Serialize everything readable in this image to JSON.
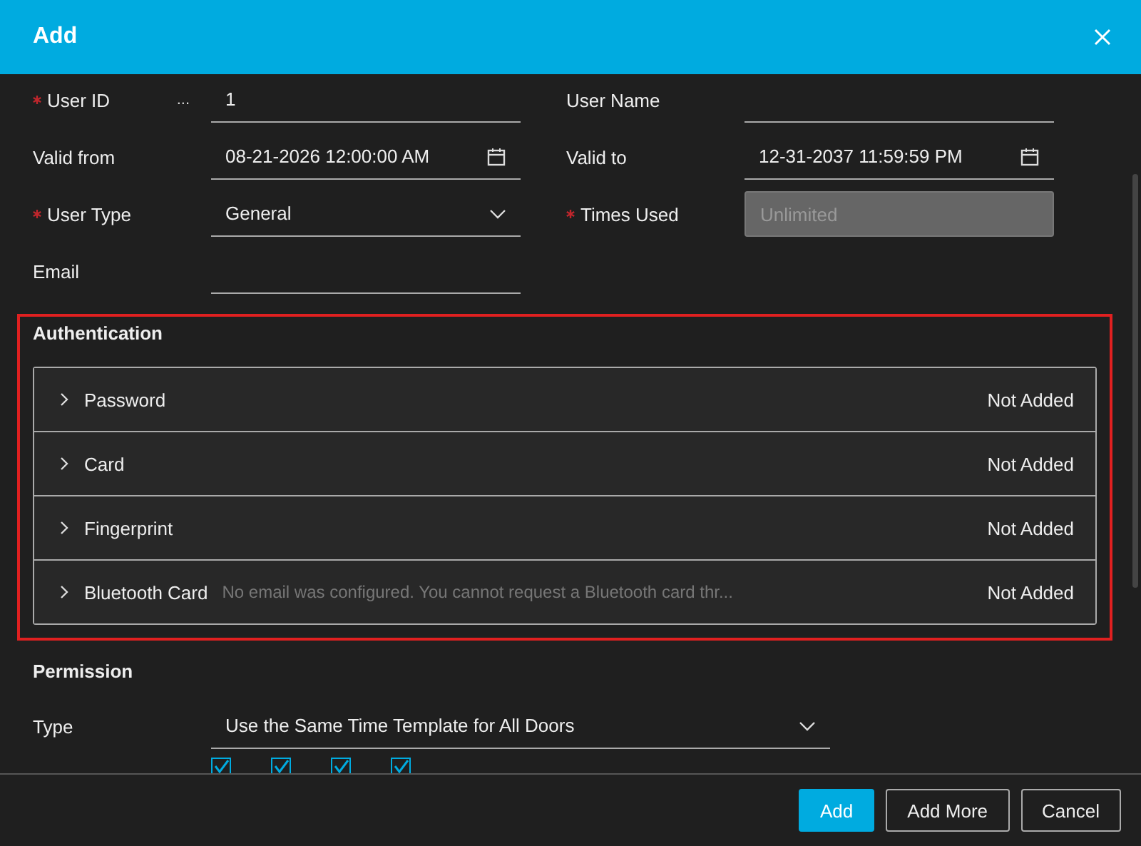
{
  "window": {
    "title": "Add"
  },
  "fields": [
    {
      "label": "User ID",
      "required": true,
      "kind": "text",
      "value": "1",
      "more": "..."
    },
    {
      "label": "User Name",
      "required": false,
      "kind": "text"
    },
    {
      "label": "Valid from",
      "required": false,
      "kind": "date",
      "value": "08-21-2026 12:00:00 AM"
    },
    {
      "label": "Valid to",
      "required": false,
      "kind": "date",
      "value": "12-31-2037 11:59:59 PM"
    },
    {
      "label": "User Type",
      "required": true,
      "kind": "select",
      "value": "General"
    },
    {
      "label": "Times Used",
      "required": true,
      "kind": "disabled",
      "placeholder": "Unlimited"
    },
    {
      "label": "Email",
      "required": false,
      "kind": "text"
    }
  ],
  "authentication": {
    "title": "Authentication",
    "items": [
      {
        "name": "Password",
        "status": "Not Added",
        "expanded": false
      },
      {
        "name": "Card",
        "status": "Not Added",
        "expanded": false
      },
      {
        "name": "Fingerprint",
        "status": "Not Added",
        "expanded": false
      },
      {
        "name": "Bluetooth Card",
        "note": "No email was configured. You cannot request a Bluetooth card thr...",
        "status": "Not Added",
        "expanded": false
      }
    ]
  },
  "permission": {
    "title": "Permission",
    "type_label": "Type",
    "type_value": "Use the Same Time Template for All Doors",
    "doors": [
      {
        "checked": true
      },
      {
        "checked": true
      },
      {
        "checked": true
      },
      {
        "checked": true
      }
    ]
  },
  "buttons": [
    {
      "label": "Add",
      "primary": true
    },
    {
      "label": "Add More",
      "primary": false
    },
    {
      "label": "Cancel",
      "primary": false
    }
  ]
}
